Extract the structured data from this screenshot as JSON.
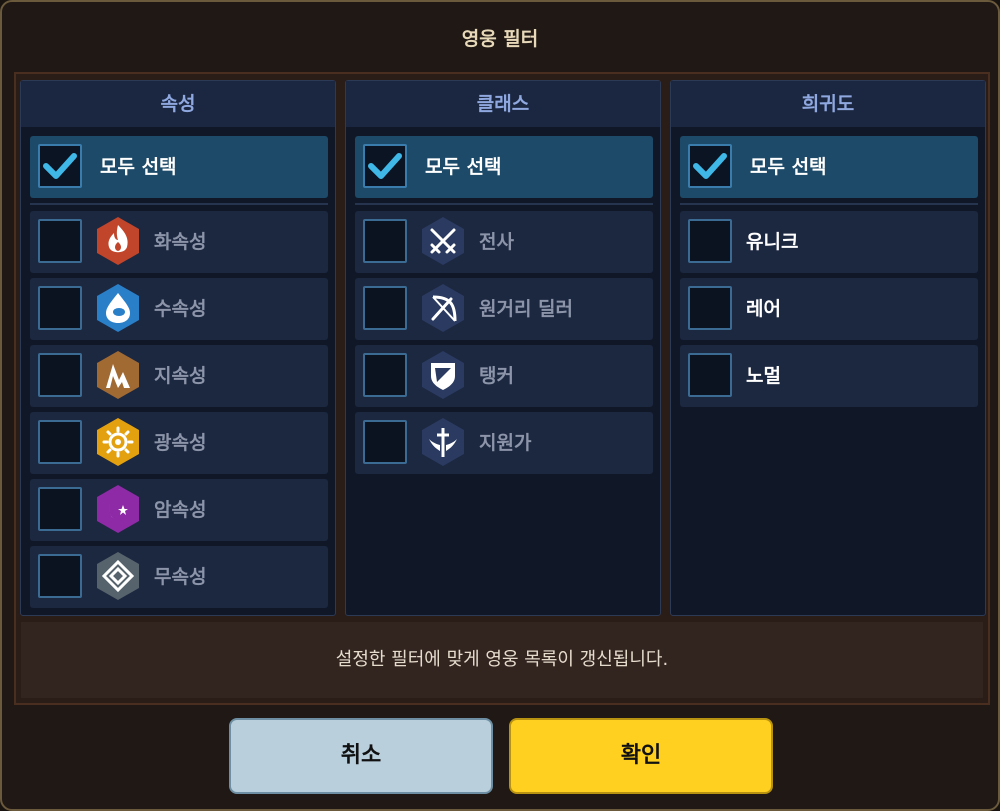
{
  "title": "영웅 필터",
  "columns": [
    {
      "header": "속성",
      "select_all": "모두 선택",
      "items": [
        {
          "label": "화속성",
          "icon": "fire-icon",
          "color": "#c0452a"
        },
        {
          "label": "수속성",
          "icon": "water-icon",
          "color": "#2a7fc9"
        },
        {
          "label": "지속성",
          "icon": "earth-icon",
          "color": "#a06a32"
        },
        {
          "label": "광속성",
          "icon": "light-icon",
          "color": "#e3a10f"
        },
        {
          "label": "암속성",
          "icon": "dark-icon",
          "color": "#8e2aa6"
        },
        {
          "label": "무속성",
          "icon": "neutral-icon",
          "color": "#56636c"
        }
      ]
    },
    {
      "header": "클래스",
      "select_all": "모두 선택",
      "items": [
        {
          "label": "전사",
          "icon": "crossed-swords-icon",
          "color": "#2a3a60"
        },
        {
          "label": "원거리 딜러",
          "icon": "bow-icon",
          "color": "#2a3a60"
        },
        {
          "label": "탱커",
          "icon": "shield-icon",
          "color": "#2a3a60"
        },
        {
          "label": "지원가",
          "icon": "support-icon",
          "color": "#2a3a60"
        }
      ]
    },
    {
      "header": "희귀도",
      "select_all": "모두 선택",
      "items": [
        {
          "label": "유니크"
        },
        {
          "label": "레어"
        },
        {
          "label": "노멀"
        }
      ]
    }
  ],
  "note": "설정한 필터에 맞게 영웅 목록이 갱신됩니다.",
  "buttons": {
    "cancel": "취소",
    "confirm": "확인"
  },
  "colors": {
    "accent": "#3fb8e8",
    "confirm": "#ffd01f",
    "cancel": "#b9cfdc",
    "header_text": "#8fa8e0"
  }
}
